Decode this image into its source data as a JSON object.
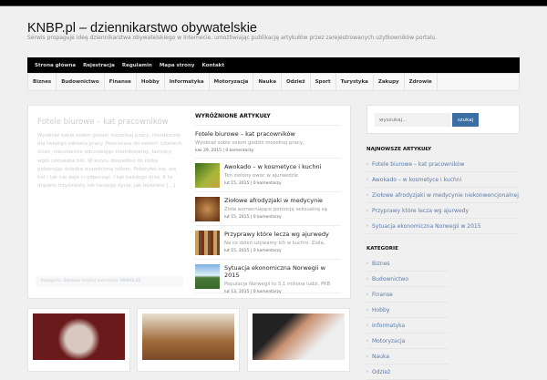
{
  "site": {
    "title": "KNBP.pl – dziennikarstwo obywatelskie",
    "tagline": "Serwis propaguje ideę dziennikarstwa obywatelskiego w Internecie, umożliwiając publikację artykułów przez zarejestrowanych użytkowników portalu."
  },
  "nav": [
    "Strona główna",
    "Rejestracja",
    "Regulamin",
    "Mapa strony",
    "Kontakt"
  ],
  "categories_bar": [
    "Biznes",
    "Budownictwo",
    "Finanse",
    "Hobby",
    "Informatyka",
    "Motoryzacja",
    "Nauka",
    "Odzież",
    "Sport",
    "Turystyka",
    "Zakupy",
    "Zdrowie"
  ],
  "lead": {
    "title": "Fotele biurowe – kat pracowników",
    "text": "Wyobraź sobie osiem godzin mozolnej pracy, morderczej dla twojego zdrowia pracy. Powracasz do swoich czterech ścian, nieustannie odczuwając niemiłosierny, łamiący wpół człowieka ból. W końcu doszedłeś do łóżka pokonując ścieżkę wypełnioną bólem. Położyłeś się, ale ból i tak nie daje ci odpocząć. I tak każdego dnia. A to dopiero trzydziesty rok twojego życia, jak będziesz […]",
    "meta_prefix": "Kategoria:",
    "category": "Zdrowie",
    "author_prefix": "Artykuł autorstwa:",
    "author": "MMKOLBE"
  },
  "featured": {
    "heading": "WYRÓŻNIONE ARTYKUŁY",
    "items": [
      {
        "title": "Fotele biurowe – kat pracowników",
        "excerpt": "Wyobraź sobie osiem godzin mozolnej pracy,",
        "meta": "kwi 29, 2015 | 0 komentarzy"
      },
      {
        "title": "Awokado – w kosmetyce i kuchni",
        "excerpt": "Ten zielony owoc w ajurwedzie",
        "meta": "lut 15, 2015 | 0 komentarzy",
        "thumb": "#5a8a2a"
      },
      {
        "title": "Ziołowe afrodyzjaki w medycynie",
        "excerpt": "Zioła wzmacniające potencję seksualną są",
        "meta": "lut 15, 2015 | 0 komentarzy",
        "thumb": "#6a3a1a"
      },
      {
        "title": "Przyprawy które lecza wg ajurwedy",
        "excerpt": "Na co dzień używamy ich w kuchni. Zioła,",
        "meta": "lut 15, 2015 | 0 komentarzy",
        "thumb": "#8a6a3a"
      },
      {
        "title": "Sytuacja ekonomiczna Norwegii w 2015",
        "excerpt": "Populacja Norwegii to 5,1 miliona ludzi, PKB",
        "meta": "lut 13, 2015 | 0 komentarzy",
        "thumb": "#4a7ab0"
      }
    ]
  },
  "search": {
    "placeholder": "wyszukaj...",
    "button": "szukaj"
  },
  "latest": {
    "heading": "NAJNOWSZE ARTYKUŁY",
    "items": [
      "Fotele biurowe – kat pracowników",
      "Awokado – w kosmetyce i kuchni",
      "Ziołowe afrodyzjaki w medycynie niekonwencjonalnej",
      "Przyprawy które lecza wg ajurwedy",
      "Sytuacja ekonomiczna Norwegii w 2015"
    ]
  },
  "sidebar_categories": {
    "heading": "KATEGORIE",
    "items": [
      "Biznes",
      "Budownictwo",
      "Finanse",
      "Hobby",
      "Informatyka",
      "Motoryzacja",
      "Nauka",
      "Odzież"
    ]
  }
}
